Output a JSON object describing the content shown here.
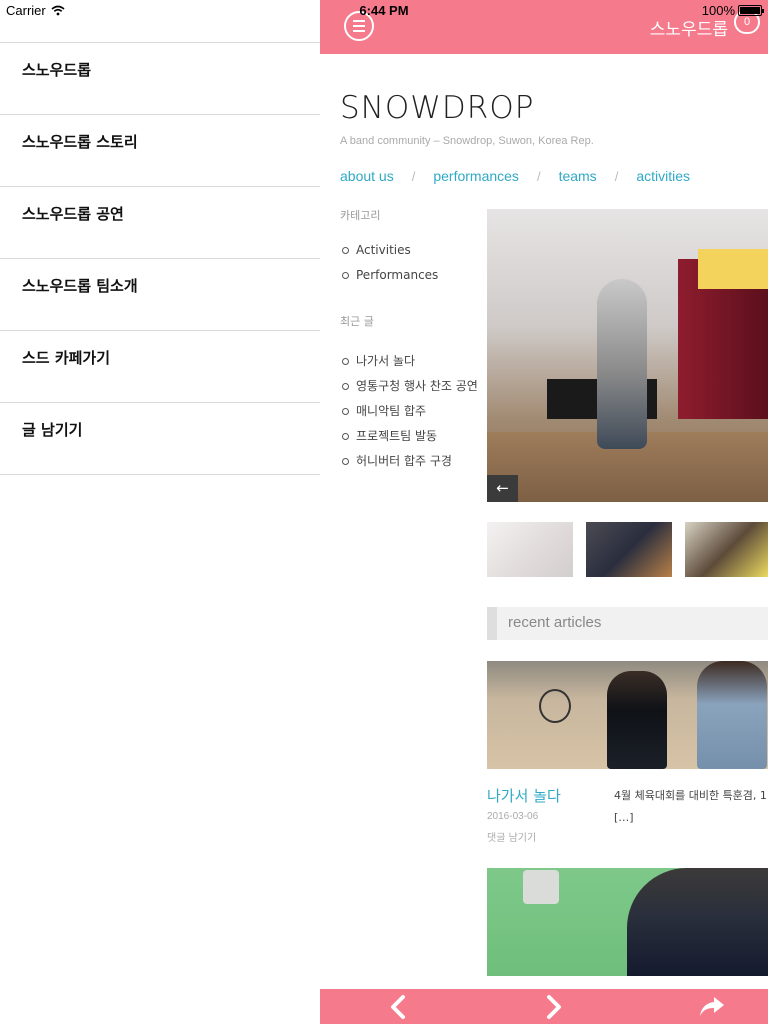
{
  "status_bar": {
    "carrier": "Carrier",
    "time": "6:44 PM",
    "battery": "100%"
  },
  "side_menu": {
    "items": [
      "스노우드롭",
      "스노우드롭 스토리",
      "스노우드롭 공연",
      "스노우드롭 팀소개",
      "스드 카페가기",
      "글 남기기"
    ]
  },
  "top_bar": {
    "title": "스노우드롭",
    "chat_count": "0",
    "color": "#f57a8c"
  },
  "site": {
    "title": "SNOWDROP",
    "tagline": "A band community – Snowdrop, Suwon, Korea Rep."
  },
  "nav": {
    "tabs": [
      "about us",
      "performances",
      "teams",
      "activities"
    ],
    "separator": "/",
    "link_color": "#2fa9c6"
  },
  "sidebar": {
    "categories_title": "카테고리",
    "categories": [
      "Activities",
      "Performances"
    ],
    "recent_title": "최근 글",
    "recent_posts": [
      "나가서 놀다",
      "영통구청 행사 찬조 공연",
      "매니악팀 합주",
      "프로젝트팀 발동",
      "허니버터 합주 구경"
    ]
  },
  "slider": {
    "prev_label": "←"
  },
  "recent_section": {
    "header": "recent articles"
  },
  "article": {
    "title": "나가서 놀다",
    "date": "2016-03-06",
    "comment_link": "댓글 남기기",
    "excerpt_line1": "4월 체육대회를 대비한 특훈겸, 1",
    "excerpt_line2": "[…]"
  },
  "icons": {
    "menu": "hamburger-menu-icon",
    "chat": "chat-bubble-icon",
    "back": "chevron-left-icon",
    "forward": "chevron-right-icon",
    "share": "share-arrow-icon"
  }
}
